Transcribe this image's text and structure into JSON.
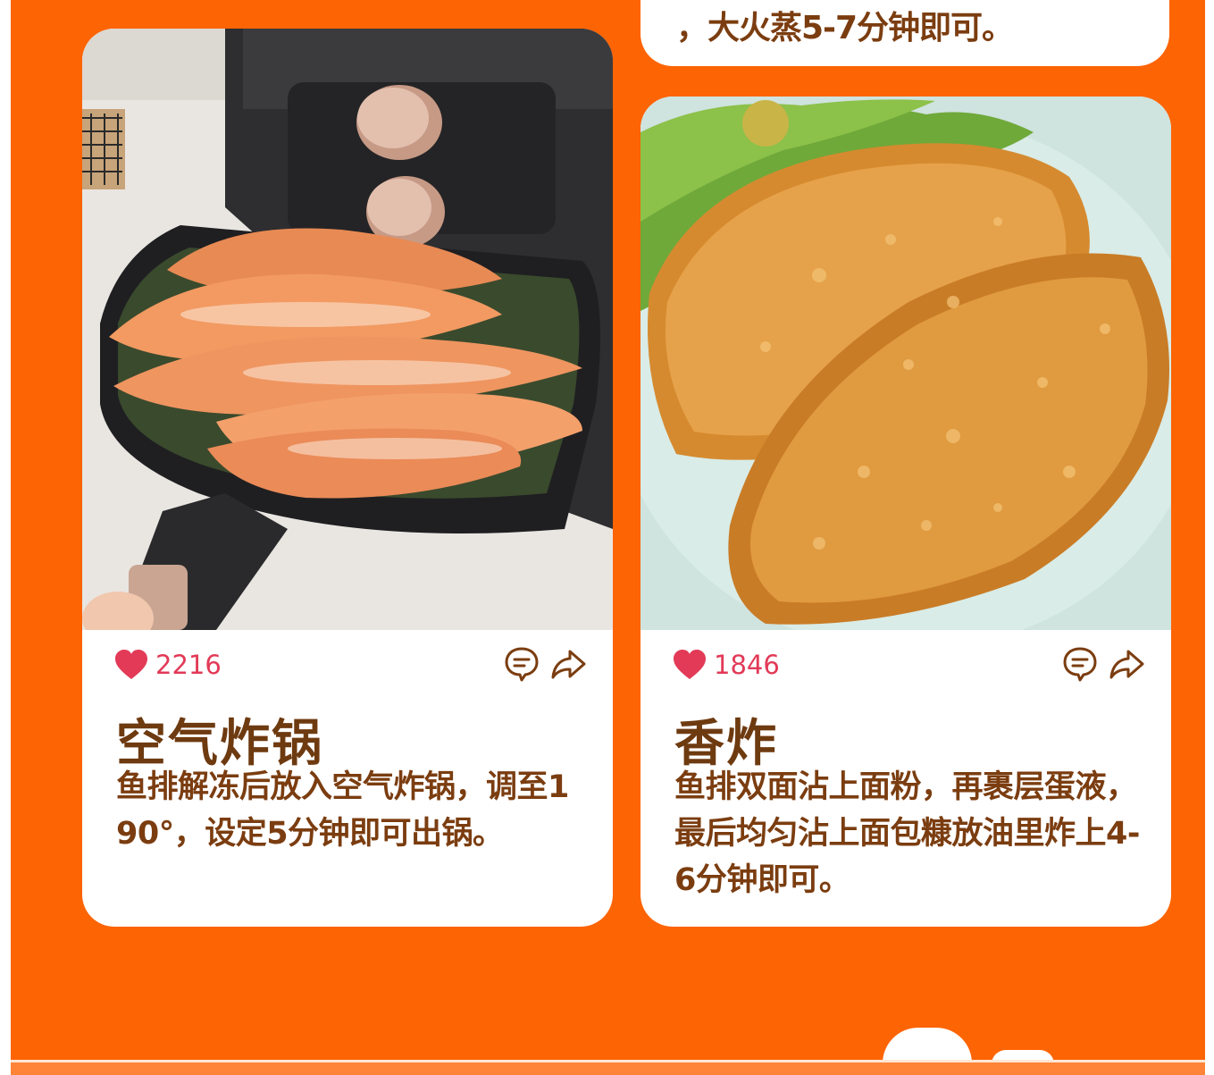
{
  "top_card": {
    "text": "，大火蒸5-7分钟即可。"
  },
  "cards": [
    {
      "likes": "2216",
      "title": "空气炸锅",
      "description": "鱼排解冻后放入空气炸锅，调至190°，设定5分钟即可出锅。",
      "photo_subject": "air-fryer-fish-fillets"
    },
    {
      "likes": "1846",
      "title": "香炸",
      "description": "鱼排双面沾上面粉，再裹层蛋液，最后均匀沾上面包糠放油里炸上4-6分钟即可。",
      "photo_subject": "fried-breaded-fish-fillets"
    }
  ],
  "icons": {
    "like": "heart-icon",
    "comment": "comment-icon",
    "share": "share-icon"
  },
  "colors": {
    "background": "#fd6404",
    "heart": "#e23a57",
    "text_brown": "#7b3d10"
  }
}
